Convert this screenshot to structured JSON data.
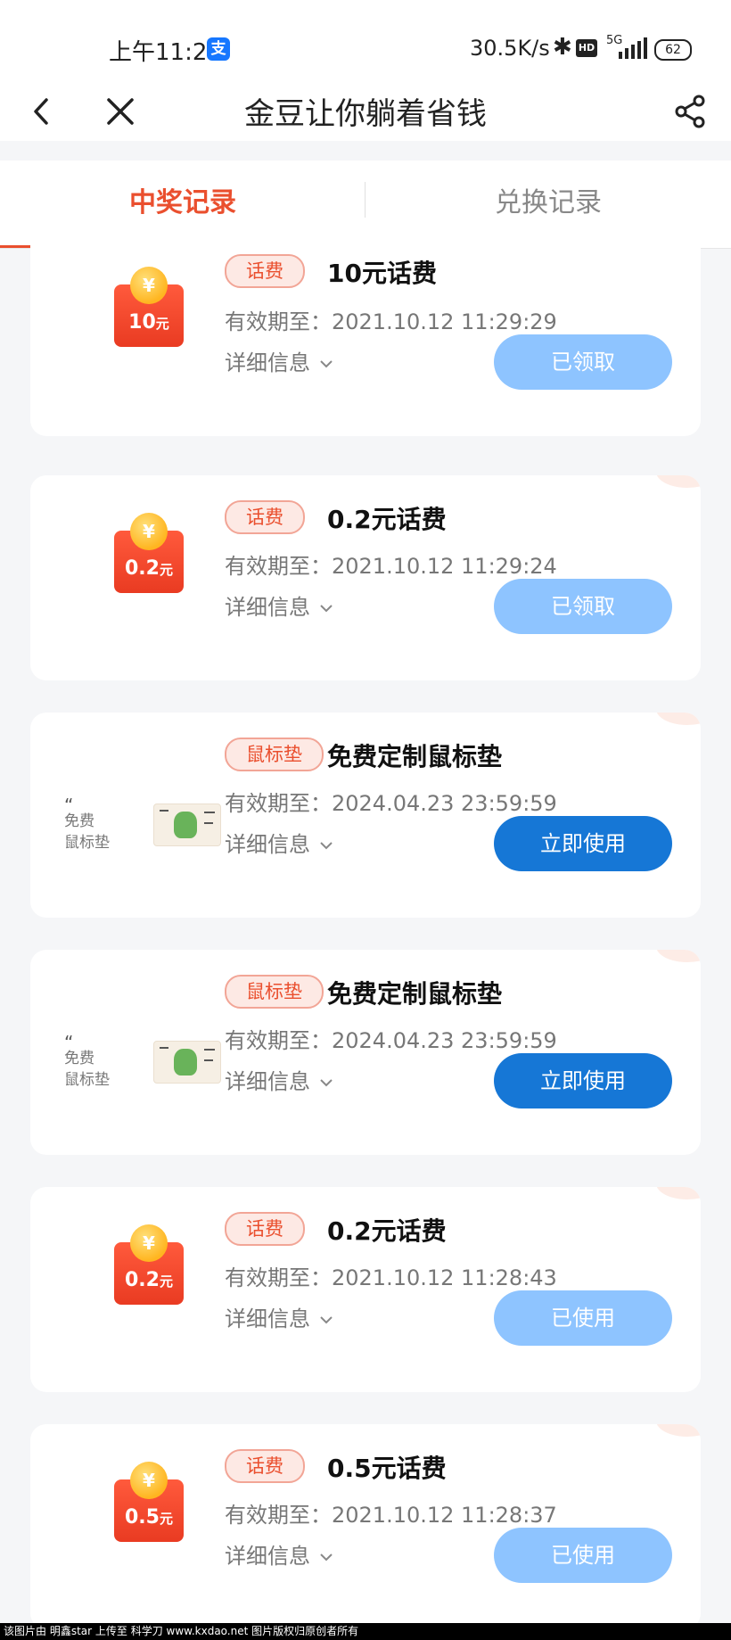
{
  "status_bar": {
    "time": "上午11:29",
    "net_speed": "30.5K/s",
    "network": "5G",
    "battery": "62"
  },
  "nav": {
    "title": "金豆让你躺着省钱"
  },
  "tabs": [
    {
      "label": "中奖记录",
      "active": true
    },
    {
      "label": "兑换记录",
      "active": false
    }
  ],
  "labels": {
    "details": "详细信息"
  },
  "cards": [
    {
      "tag": "话费",
      "title": "10元话费",
      "validity": "有效期至：2021.10.12 11:29:29",
      "button": "已领取",
      "button_state": "disabled",
      "thumb": "redpack",
      "amount": "10",
      "unit": "元"
    },
    {
      "tag": "话费",
      "title": "0.2元话费",
      "validity": "有效期至：2021.10.12 11:29:24",
      "button": "已领取",
      "button_state": "disabled",
      "thumb": "redpack",
      "amount": "0.2",
      "unit": "元"
    },
    {
      "tag": "鼠标垫",
      "title": "免费定制鼠标垫",
      "validity": "有效期至：2024.04.23 23:59:59",
      "button": "立即使用",
      "button_state": "active",
      "thumb": "mousepad",
      "thumb_label_1": "免费",
      "thumb_label_2": "鼠标垫"
    },
    {
      "tag": "鼠标垫",
      "title": "免费定制鼠标垫",
      "validity": "有效期至：2024.04.23 23:59:59",
      "button": "立即使用",
      "button_state": "active",
      "thumb": "mousepad",
      "thumb_label_1": "免费",
      "thumb_label_2": "鼠标垫"
    },
    {
      "tag": "话费",
      "title": "0.2元话费",
      "validity": "有效期至：2021.10.12 11:28:43",
      "button": "已使用",
      "button_state": "disabled",
      "thumb": "redpack",
      "amount": "0.2",
      "unit": "元"
    },
    {
      "tag": "话费",
      "title": "0.5元话费",
      "validity": "有效期至：2021.10.12 11:28:37",
      "button": "已使用",
      "button_state": "disabled",
      "thumb": "redpack",
      "amount": "0.5",
      "unit": "元"
    }
  ],
  "colors": {
    "accent": "#ea4f2e",
    "button_active": "#1677d6",
    "button_disabled": "#8ec4ff"
  },
  "watermark": "该图片由 明鑫star 上传至 科学刀 www.kxdao.net 图片版权归原创者所有"
}
